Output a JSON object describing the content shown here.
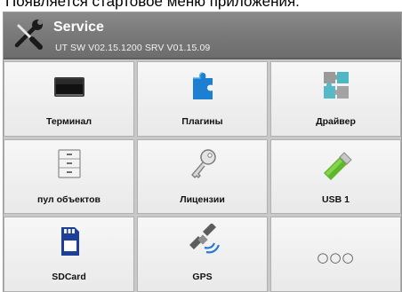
{
  "caption": "Появляется стартовое меню приложения:",
  "header": {
    "title": "Service",
    "version": "UT SW V02.15.1200 SRV V01.15.09",
    "icon": "wrench-screwdriver-icon"
  },
  "tiles": [
    {
      "label": "Терминал",
      "icon": "monitor-icon"
    },
    {
      "label": "Плагины",
      "icon": "puzzle-piece-icon"
    },
    {
      "label": "Драйвер",
      "icon": "puzzle-pieces-icon"
    },
    {
      "label": "пул объектов",
      "icon": "drawer-cabinet-icon"
    },
    {
      "label": "Лицензии",
      "icon": "key-icon"
    },
    {
      "label": "USB 1",
      "icon": "usb-stick-icon"
    },
    {
      "label": "SDCard",
      "icon": "sd-card-icon"
    },
    {
      "label": "GPS",
      "icon": "satellite-icon"
    },
    {
      "label": "",
      "icon": "more-icon",
      "dots": "○○○"
    }
  ],
  "colors": {
    "header": "#7a7a7a",
    "tile": "#efefef",
    "plugin_blue": "#1d7fd1",
    "usb_green": "#5cb82a",
    "sd_blue": "#1c3f9a"
  }
}
